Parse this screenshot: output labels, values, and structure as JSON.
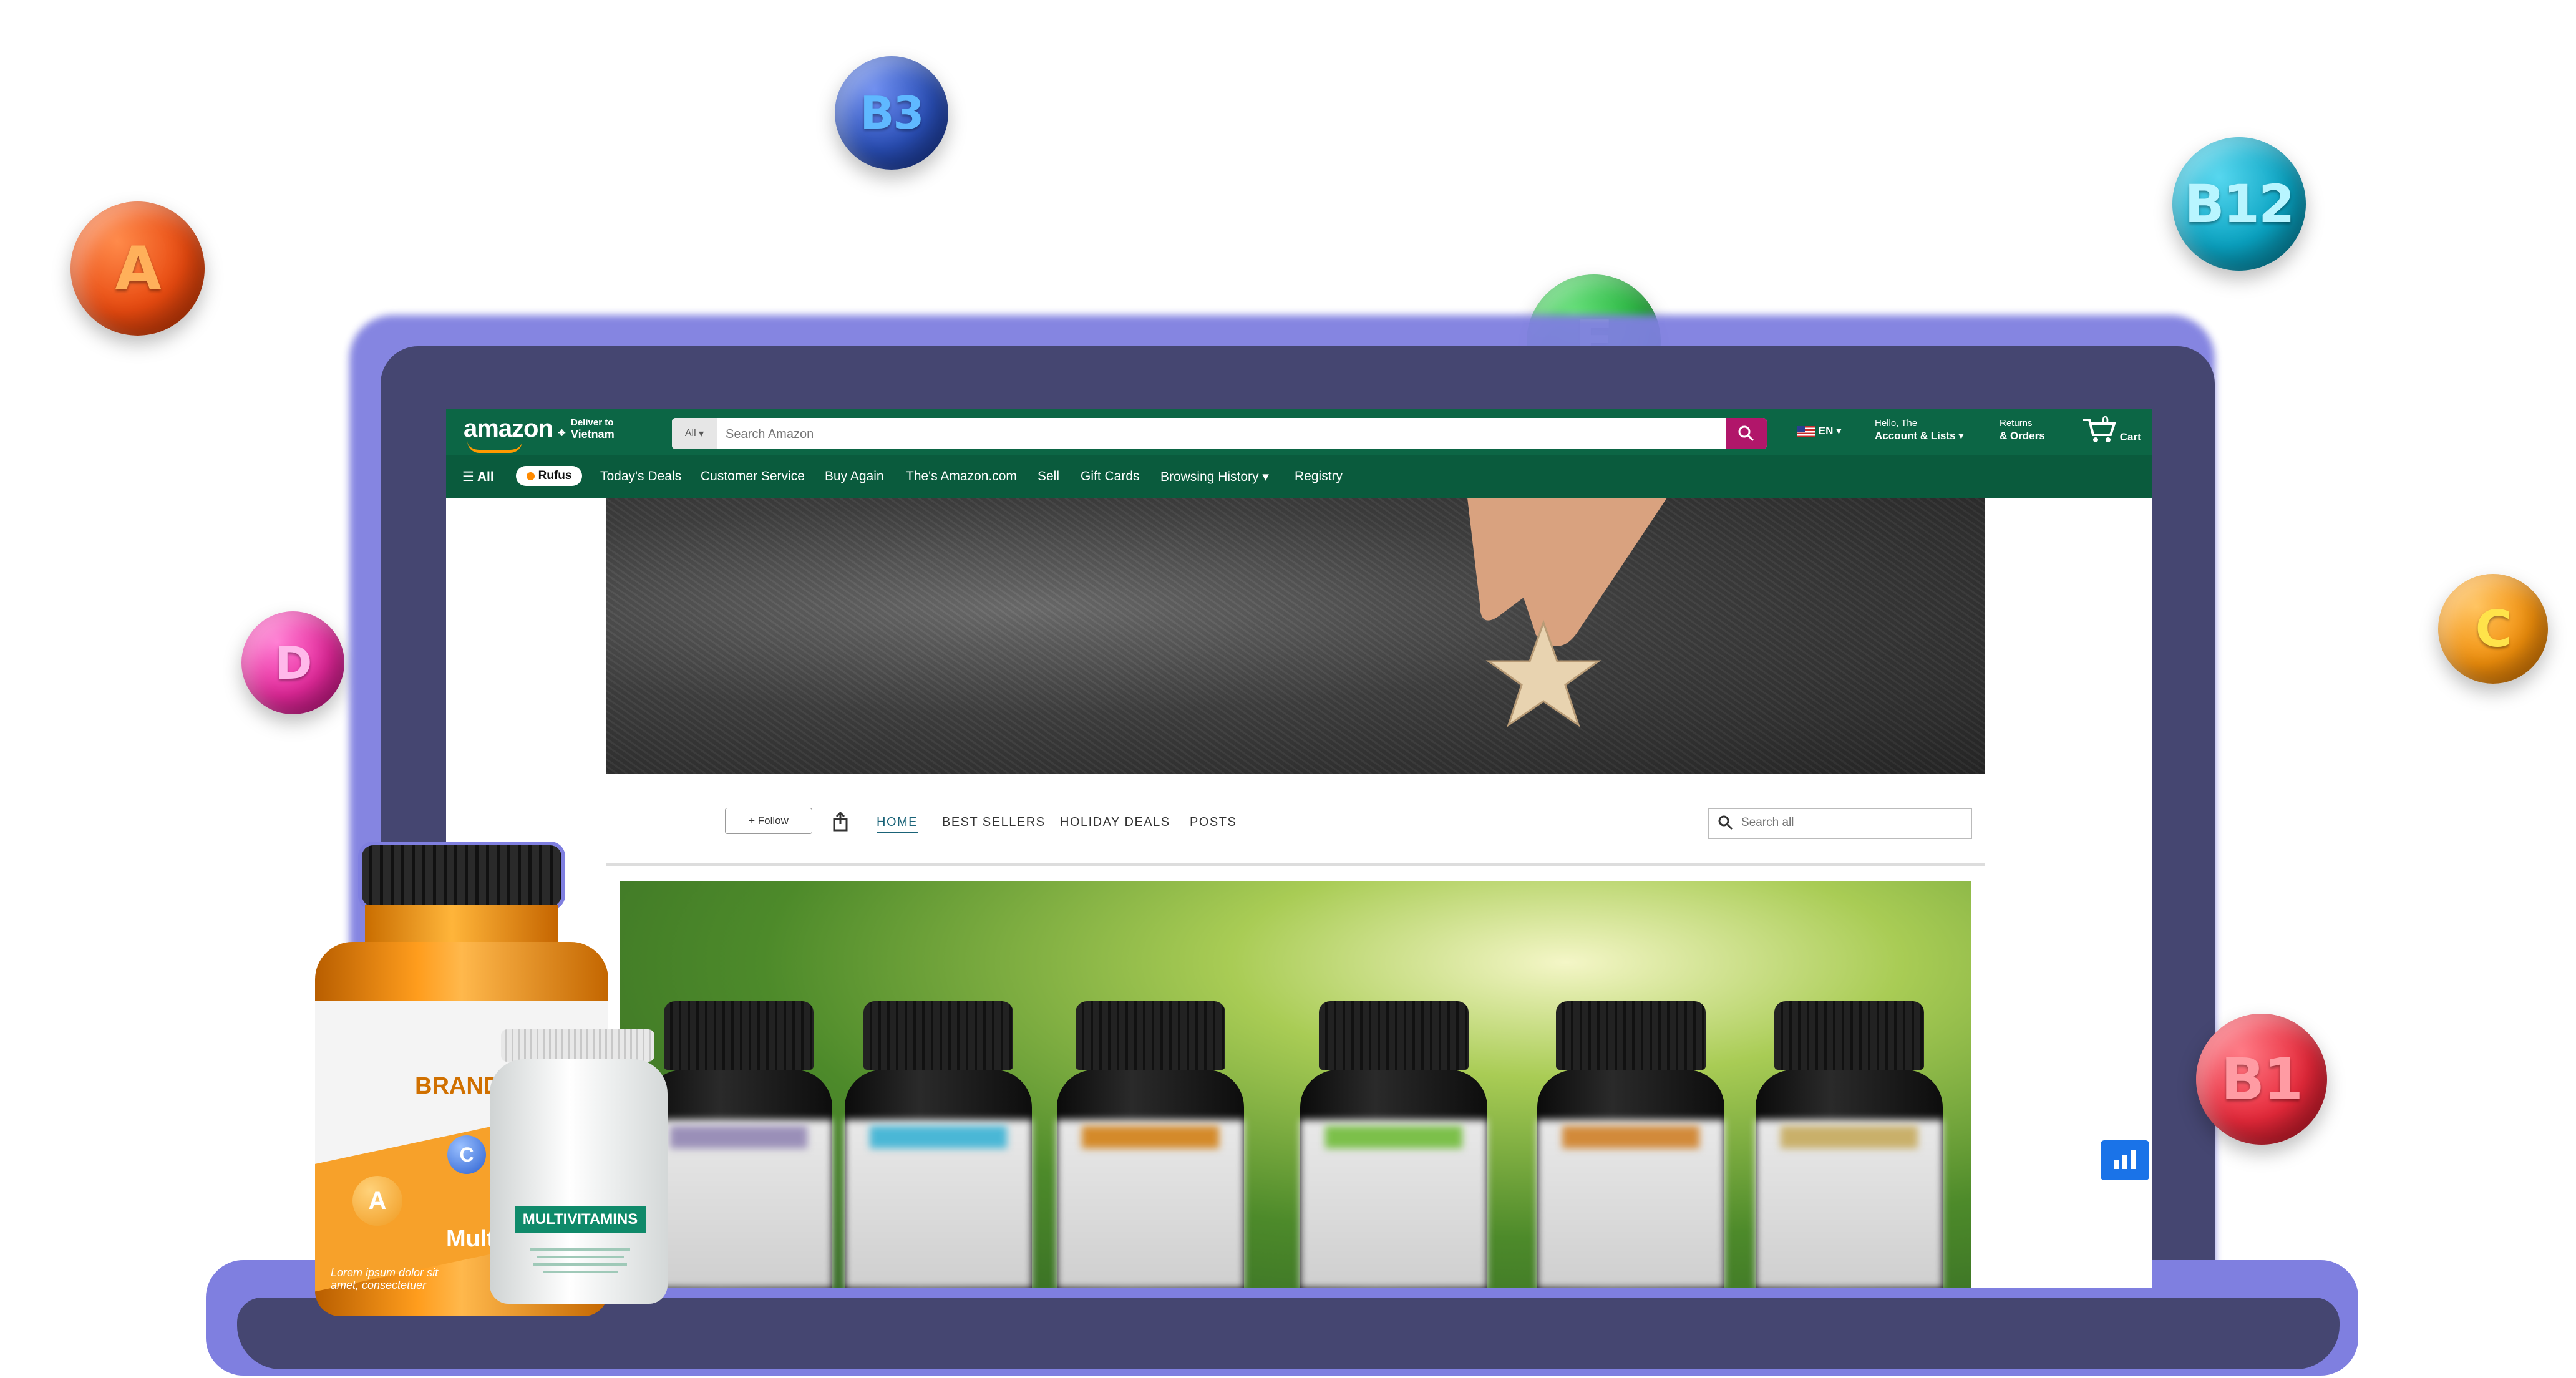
{
  "vitamins": [
    {
      "label": "A",
      "color": "#e84a10"
    },
    {
      "label": "B3",
      "color": "#2a4fb7"
    },
    {
      "label": "B12",
      "color": "#0aa3c2"
    },
    {
      "label": "E",
      "color": "#22b13a"
    },
    {
      "label": "D",
      "color": "#e6299c"
    },
    {
      "label": "C",
      "color": "#f2900c"
    },
    {
      "label": "B1",
      "color": "#e6293a"
    }
  ],
  "amazon": {
    "logo": "amazon",
    "deliver_line1": "Deliver to",
    "deliver_line2": "Vietnam",
    "search_category": "All",
    "search_placeholder": "Search Amazon",
    "language": "EN",
    "account_line1": "Hello, The",
    "account_line2": "Account & Lists",
    "returns_line1": "Returns",
    "returns_line2": "& Orders",
    "cart_count": "0",
    "cart_label": "Cart",
    "nav": {
      "all": "All",
      "rufus": "Rufus",
      "items": [
        "Today's Deals",
        "Customer Service",
        "Buy Again",
        "The's Amazon.com",
        "Sell",
        "Gift Cards",
        "Browsing History",
        "Registry"
      ]
    }
  },
  "store": {
    "follow_label": "+ Follow",
    "tabs": [
      "HOME",
      "BEST SELLERS",
      "HOLIDAY DEALS",
      "POSTS"
    ],
    "active_tab": "HOME",
    "search_placeholder": "Search all"
  },
  "products": {
    "big_bottle_brand": "BRAND",
    "big_bottle_partial": "Mult",
    "big_bottle_lorem": "Lorem ipsum dolor sit amet, consectetuer",
    "small_bottle_label": "MULTIVITAMINS",
    "vit_a": "A",
    "vit_c": "C"
  },
  "colors": {
    "amazon_header": "#0c6645",
    "search_button": "#b1166a",
    "laptop_frame": "#454671",
    "laptop_glow": "#7f7fe0"
  }
}
